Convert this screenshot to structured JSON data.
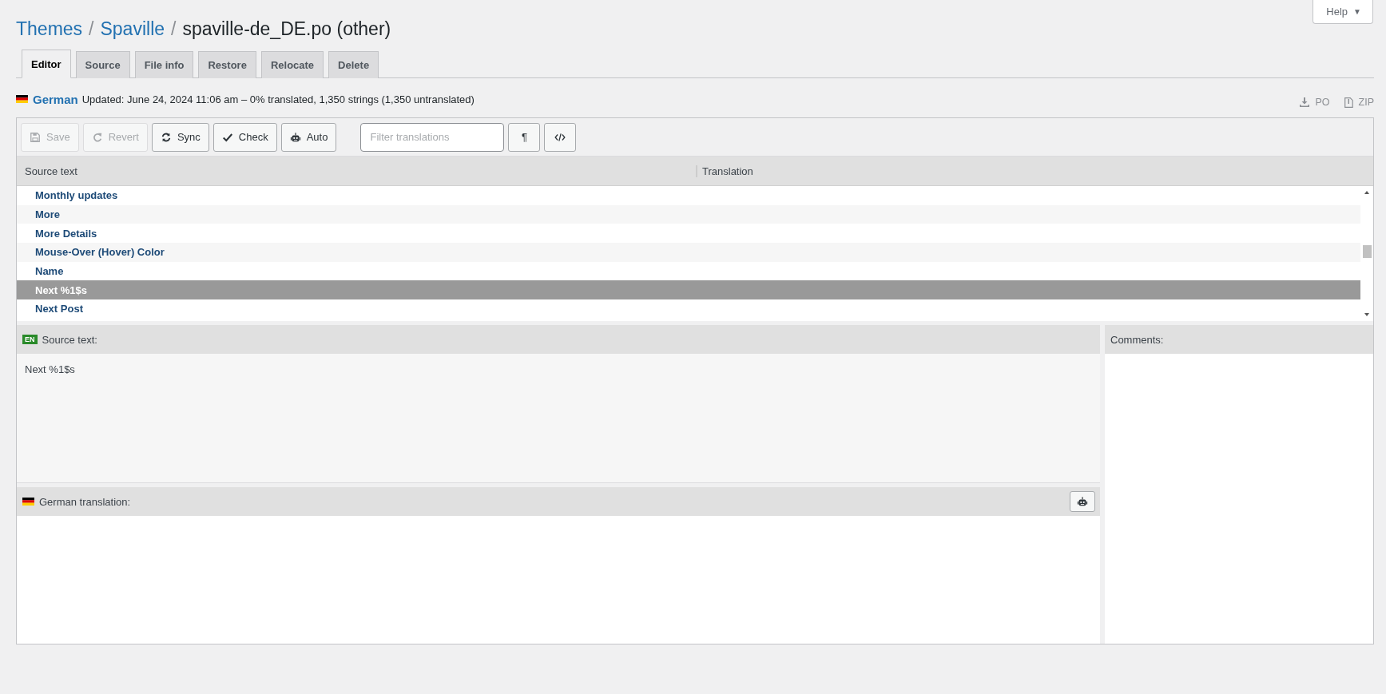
{
  "help_button": {
    "label": "Help",
    "caret": "▼"
  },
  "breadcrumb": [
    {
      "label": "Themes",
      "link": true
    },
    {
      "label": "Spaville",
      "link": true
    },
    {
      "label": "spaville-de_DE.po (other)",
      "link": false
    }
  ],
  "breadcrumb_separator": "/",
  "tabs": [
    {
      "label": "Editor",
      "selected": true
    },
    {
      "label": "Source",
      "selected": false
    },
    {
      "label": "File info",
      "selected": false
    },
    {
      "label": "Restore",
      "selected": false
    },
    {
      "label": "Relocate",
      "selected": false
    },
    {
      "label": "Delete",
      "selected": false
    }
  ],
  "language": {
    "name": "German",
    "summary": "Updated: June 24, 2024 11:06 am – 0% translated, 1,350 strings (1,350 untranslated)"
  },
  "downloads": [
    {
      "label": "PO",
      "kind": "download"
    },
    {
      "label": "ZIP",
      "kind": "archive"
    }
  ],
  "toolbar": [
    {
      "label": "Save",
      "kind": "save",
      "disabled": true
    },
    {
      "label": "Revert",
      "kind": "revert",
      "disabled": true
    },
    {
      "label": "Sync",
      "kind": "sync",
      "disabled": false
    },
    {
      "label": "Check",
      "kind": "check",
      "disabled": false
    },
    {
      "label": "Auto",
      "kind": "robot",
      "disabled": false
    }
  ],
  "filter": {
    "placeholder": "Filter translations"
  },
  "view_buttons": [
    {
      "kind": "text",
      "label": "¶"
    },
    {
      "kind": "code"
    }
  ],
  "columns": [
    "Source text",
    "Translation"
  ],
  "rows": [
    {
      "source": "Monthly updates",
      "selected": false
    },
    {
      "source": "More",
      "selected": false
    },
    {
      "source": "More Details",
      "selected": false
    },
    {
      "source": "Mouse-Over (Hover) Color",
      "selected": false
    },
    {
      "source": "Name",
      "selected": false
    },
    {
      "source": "Next %1$s",
      "selected": true
    },
    {
      "source": "Next Post",
      "selected": false
    }
  ],
  "source_pane": {
    "badge": "EN",
    "title": "Source text:",
    "text": "Next %1$s"
  },
  "translation_pane": {
    "title": "German translation:"
  },
  "comments_pane": {
    "title": "Comments:"
  }
}
